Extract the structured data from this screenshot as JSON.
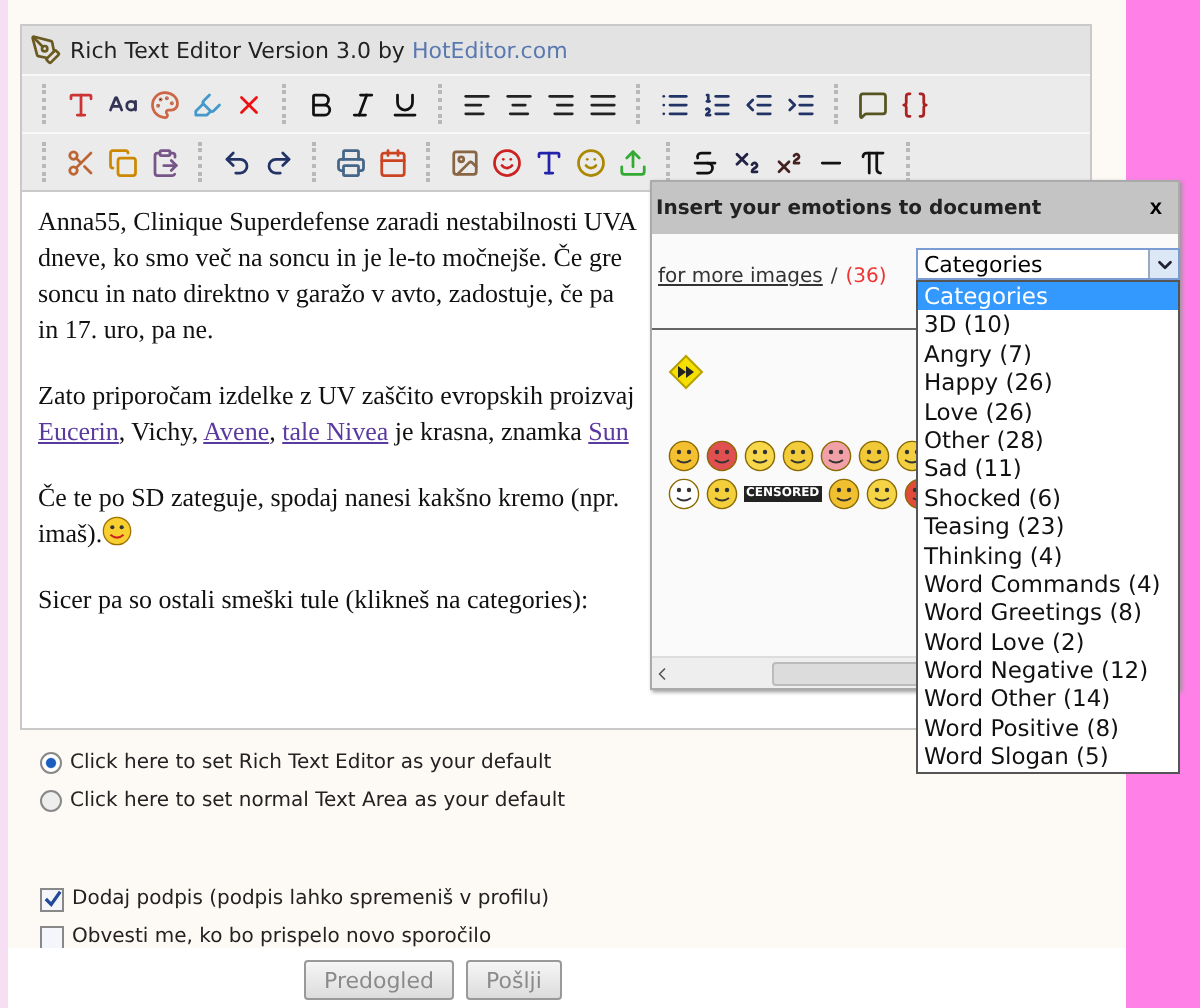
{
  "editor": {
    "title": "Rich Text Editor Version 3.0 by",
    "title_link": "HotEditor.com",
    "paragraphs": [
      {
        "lines": [
          [
            {
              "text": "Anna55, Clinique Superdefense zaradi nestabilnosti UVA"
            }
          ],
          [
            {
              "text": "dneve, ko smo več na soncu in je le-to močnejše. Če gre"
            }
          ],
          [
            {
              "text": "soncu in nato direktno v garažo v avto, zadostuje, če pa"
            }
          ],
          [
            {
              "text": "in 17. uro, pa ne."
            }
          ]
        ]
      },
      {
        "lines": [
          [
            {
              "text": "Zato priporočam izdelke z UV zaščito evropskih proizvaj"
            }
          ],
          [
            {
              "text": "Eucerin",
              "kind": "link"
            },
            {
              "text": ", Vichy, "
            },
            {
              "text": "Avene",
              "kind": "link"
            },
            {
              "text": ", "
            },
            {
              "text": "tale Nivea",
              "kind": "link"
            },
            {
              "text": " je krasna, znamka "
            },
            {
              "text": "Sun",
              "kind": "link"
            }
          ]
        ]
      },
      {
        "lines": [
          [
            {
              "text": "Če te po SD zateguje, spodaj nanesi kakšno kremo (npr."
            }
          ],
          [
            {
              "text": "imaš)."
            },
            {
              "kind": "smiley"
            }
          ]
        ]
      },
      {
        "lines": [
          [
            {
              "text": "Sicer pa so ostali smeški tule (klikneš na categories):"
            }
          ]
        ]
      }
    ]
  },
  "popup": {
    "title": "Insert your emotions to document",
    "close": "x",
    "more_link": "for more images",
    "slash": "/",
    "count": "(36)",
    "censored_label": "CENSORED",
    "select": {
      "value": "Categories",
      "open": true,
      "options": [
        {
          "label": "Categories",
          "selected": true
        },
        {
          "label": "3D (10)",
          "selected": false
        },
        {
          "label": "Angry (7)",
          "selected": false
        },
        {
          "label": "Happy (26)",
          "selected": false
        },
        {
          "label": "Love (26)",
          "selected": false
        },
        {
          "label": "Other (28)",
          "selected": false
        },
        {
          "label": "Sad (11)",
          "selected": false
        },
        {
          "label": "Shocked (6)",
          "selected": false
        },
        {
          "label": "Teasing (23)",
          "selected": false
        },
        {
          "label": "Thinking (4)",
          "selected": false
        },
        {
          "label": "Word Commands (4)",
          "selected": false
        },
        {
          "label": "Word Greetings (8)",
          "selected": false
        },
        {
          "label": "Word Love (2)",
          "selected": false
        },
        {
          "label": "Word Negative (12)",
          "selected": false
        },
        {
          "label": "Word Other (14)",
          "selected": false
        },
        {
          "label": "Word Positive (8)",
          "selected": false
        },
        {
          "label": "Word Slogan (5)",
          "selected": false
        }
      ]
    }
  },
  "radios": [
    {
      "label": "Click here to set Rich Text Editor as your default",
      "selected": true
    },
    {
      "label": "Click here to set normal Text Area as your default",
      "selected": false
    }
  ],
  "checkboxes": [
    {
      "label": "Dodaj podpis (podpis lahko spremeniš v profilu)",
      "checked": true
    },
    {
      "label": "Obvesti me, ko bo prispelo novo sporočilo",
      "checked": false
    }
  ],
  "buttons": [
    {
      "label": "Predogled",
      "disabled": true
    },
    {
      "label": "Pošlji",
      "disabled": true
    }
  ]
}
